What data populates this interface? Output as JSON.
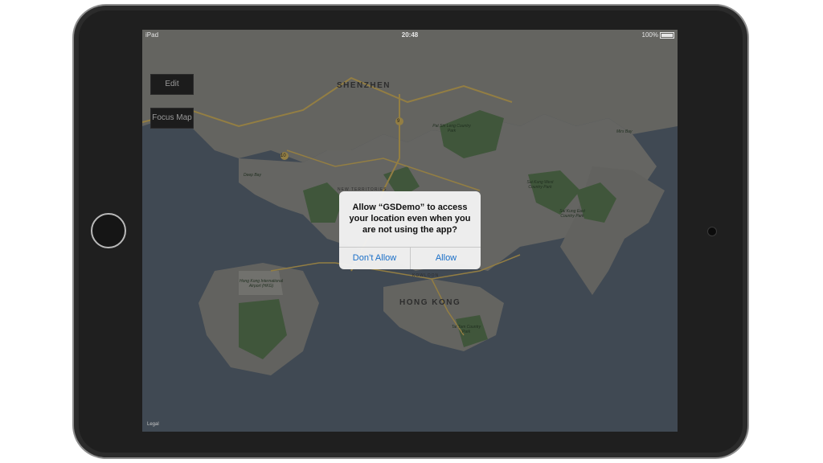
{
  "status_bar": {
    "left": "iPad",
    "time": "20:48",
    "battery": "100%"
  },
  "buttons": {
    "edit": "Edit",
    "focus_map": "Focus Map"
  },
  "map_labels": {
    "shenzhen": "SHENZHEN",
    "hong_kong": "HONG KONG",
    "kowloon": "KOWLOON",
    "new_territories": "NEW TERRITORIES",
    "deep_bay": "Deep Bay",
    "mirs_bay": "Mirs Bay",
    "pat_sin_leng": "Pat Sin Leng Country Park",
    "sai_kung_west": "Sai Kung West Country Park",
    "sai_kung_east": "Sai Kung East Country Park",
    "tai_tam": "Tai Tam Country Park",
    "airport": "Hong Kong International Airport (HKG)",
    "road_9": "9",
    "road_10": "10",
    "legal": "Legal"
  },
  "alert": {
    "message": "Allow “GSDemo” to access your location even when you are not using the app?",
    "dont_allow": "Don’t Allow",
    "allow": "Allow"
  }
}
